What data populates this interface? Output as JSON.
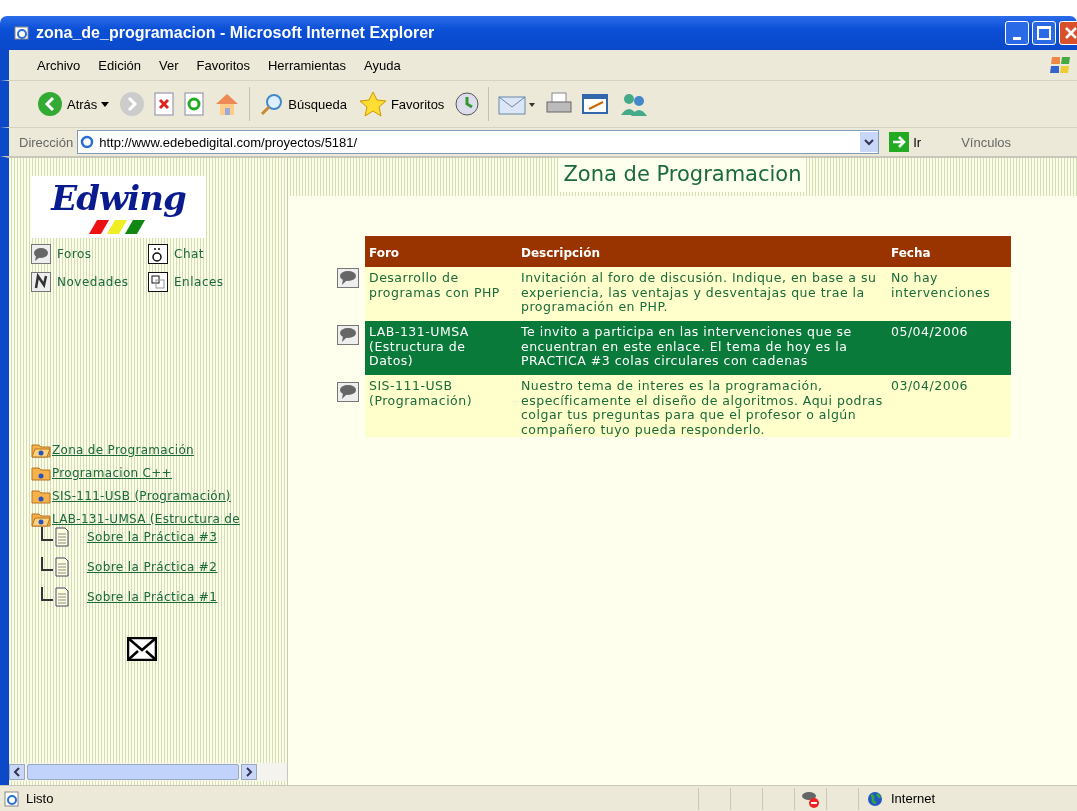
{
  "window": {
    "title": "zona_de_programacion - Microsoft Internet Explorer"
  },
  "menu": [
    "Archivo",
    "Edición",
    "Ver",
    "Favoritos",
    "Herramientas",
    "Ayuda"
  ],
  "toolbar": {
    "back": "Atrás",
    "search": "Búsqueda",
    "favorites": "Favoritos"
  },
  "address_bar": {
    "label": "Dirección",
    "value": "http://www.edebedigital.com/proyectos/5181/",
    "go": "Ir",
    "links": "Vínculos"
  },
  "sidebar": {
    "logo": "Edwing",
    "nav": [
      {
        "kind": "forum",
        "label": "Foros"
      },
      {
        "kind": "chat",
        "label": "Chat"
      },
      {
        "kind": "news",
        "label": "Novedades"
      },
      {
        "kind": "links",
        "label": "Enlaces"
      }
    ],
    "tree": [
      {
        "kind": "folder",
        "label": "Zona de Programación",
        "expanded": true
      },
      {
        "kind": "folder",
        "label": "Programacion C++",
        "expanded": false
      },
      {
        "kind": "folder",
        "label": "SIS-111-USB (Programación)",
        "expanded": false
      },
      {
        "kind": "folder",
        "label": "LAB-131-UMSA (Estructura de",
        "expanded": true,
        "children": [
          {
            "kind": "page",
            "label": "Sobre la Práctica #3"
          },
          {
            "kind": "page",
            "label": "Sobre la Práctica #2"
          },
          {
            "kind": "page",
            "label": "Sobre la Práctica #1"
          }
        ]
      }
    ]
  },
  "page": {
    "title": "Zona de Programacion",
    "table": {
      "columns": [
        "Foro",
        "Descripción",
        "Fecha"
      ],
      "rows": [
        {
          "foro": "Desarrollo de programas con PHP",
          "descripcion": "Invitación al foro de discusión. Indique, en base a su experiencia, las ventajas y desventajas que trae la programación en PHP.",
          "fecha": "No hay intervenciones",
          "highlighted": false
        },
        {
          "foro": "LAB-131-UMSA (Estructura de Datos)",
          "descripcion": "Te invito a participa en las intervenciones que se encuentran en este enlace. El tema de hoy es la PRACTICA #3 colas circulares con cadenas",
          "fecha": "05/04/2006",
          "highlighted": true
        },
        {
          "foro": "SIS-111-USB (Programación)",
          "descripcion": "Nuestro tema de interes es la programación, específicamente el diseño de algoritmos. Aqui podras colgar tus preguntas para que el profesor o algún compañero tuyo pueda responderlo.",
          "fecha": "03/04/2006",
          "highlighted": false
        }
      ]
    }
  },
  "status_bar": {
    "text": "Listo",
    "zone": "Internet"
  }
}
